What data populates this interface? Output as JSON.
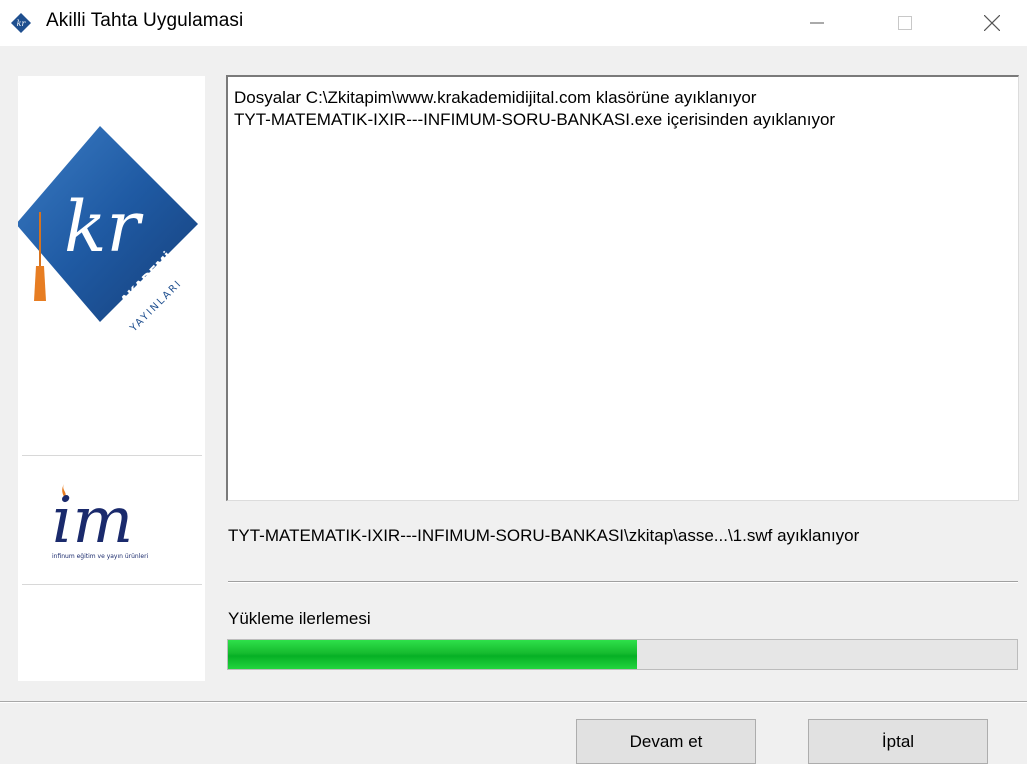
{
  "window": {
    "title": "Akilli Tahta Uygulamasi",
    "icon": "kr-logo-icon",
    "controls": {
      "minimize": "—",
      "maximize": "☐",
      "close": "✕"
    }
  },
  "sidebar": {
    "logo_primary": "kr-akademi-logo",
    "logo_primary_text": "kr",
    "logo_primary_sub": "AKADEMİ",
    "logo_primary_sub2": "YAYINLARI",
    "logo_secondary": "im-logo",
    "logo_secondary_text": "im",
    "logo_secondary_caption": "infinum eğitim ve yayın ürünleri"
  },
  "log": {
    "lines": [
      "Dosyalar C:\\Zkitapim\\www.krakademidijital.com klasörüne ayıklanıyor",
      "TYT-MATEMATIK-IXIR---INFIMUM-SORU-BANKASI.exe içerisinden ayıklanıyor"
    ]
  },
  "status": {
    "current_file": "TYT-MATEMATIK-IXIR---INFIMUM-SORU-BANKASI\\zkitap\\asse...\\1.swf ayıklanıyor",
    "progress_label": "Yükleme ilerlemesi",
    "progress_fraction": 0.518,
    "progress_color": "#06b025"
  },
  "buttons": {
    "continue_label": "Devam et",
    "cancel_label": "İptal"
  }
}
